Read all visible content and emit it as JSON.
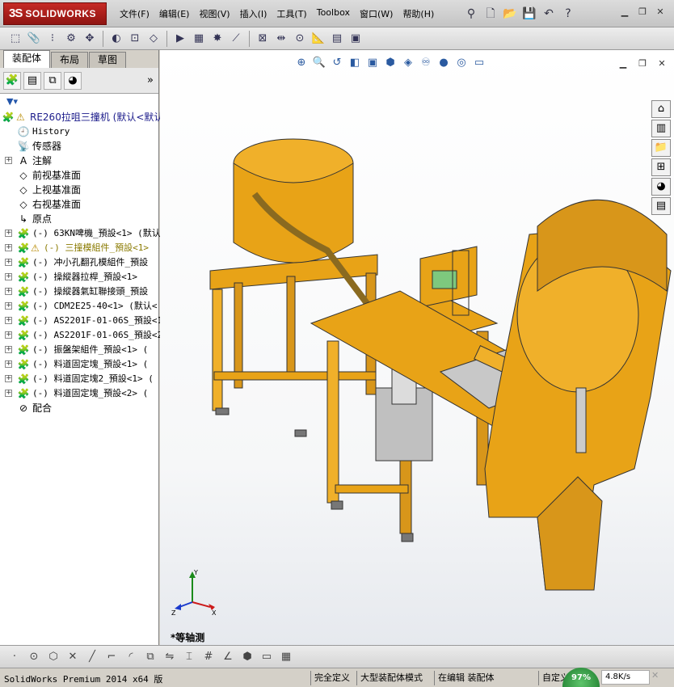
{
  "app": {
    "logo_ds": "3S",
    "logo_text": "SOLIDWORKS"
  },
  "menubar": [
    {
      "label": "文件(F)"
    },
    {
      "label": "编辑(E)"
    },
    {
      "label": "视图(V)"
    },
    {
      "label": "插入(I)"
    },
    {
      "label": "工具(T)"
    },
    {
      "label": "Toolbox"
    },
    {
      "label": "窗口(W)"
    },
    {
      "label": "帮助(H)"
    }
  ],
  "title_tools": [
    "pin-icon",
    "new-doc-icon",
    "open-icon",
    "save-icon",
    "undo-icon",
    "help-icon"
  ],
  "window_controls": [
    "minimize-icon",
    "restore-icon",
    "close-icon"
  ],
  "command_toolbar_icons": [
    "insert-component-icon",
    "mate-icon",
    "linear-pattern-icon",
    "smart-fasteners-icon",
    "move-component-icon",
    "show-hidden-icon",
    "assembly-features-icon",
    "reference-geometry-icon",
    "new-motion-study-icon",
    "bill-of-materials-icon",
    "exploded-view-icon",
    "explode-line-icon",
    "interference-detection-icon",
    "clearance-icon",
    "hole-alignment-icon",
    "measure-icon",
    "assembly-visualization-icon",
    "performance-icon"
  ],
  "feature_manager": {
    "tabs": [
      {
        "label": "装配体",
        "active": true
      },
      {
        "label": "布局",
        "active": false
      },
      {
        "label": "草图",
        "active": false
      }
    ],
    "panel_icons": [
      "featuremanager-icon",
      "propertymanager-icon",
      "configurationmanager-icon",
      "displaymanager-icon"
    ],
    "more": "»",
    "filter_icon": "filter-icon",
    "tree": [
      {
        "label": "RE260拉咀三撞机  (默认<默认",
        "icon": "assembly-icon",
        "warn": true,
        "expand": "",
        "top": true
      },
      {
        "label": "History",
        "icon": "history-icon",
        "warn": false,
        "expand": "",
        "sub": true
      },
      {
        "label": "传感器",
        "icon": "sensor-icon",
        "warn": false,
        "expand": ""
      },
      {
        "label": "注解",
        "icon": "annotation-icon",
        "warn": false,
        "expand": "+"
      },
      {
        "label": "前视基准面",
        "icon": "plane-icon",
        "warn": false,
        "expand": ""
      },
      {
        "label": "上视基准面",
        "icon": "plane-icon",
        "warn": false,
        "expand": ""
      },
      {
        "label": "右视基准面",
        "icon": "plane-icon",
        "warn": false,
        "expand": ""
      },
      {
        "label": "原点",
        "icon": "origin-icon",
        "warn": false,
        "expand": ""
      },
      {
        "label": "(-) 63KN啤機_預設<1> (默认",
        "icon": "subassembly-icon",
        "warn": false,
        "expand": "+",
        "sub": true
      },
      {
        "label": "(-) 三撞模組件_預設<1>",
        "icon": "subassembly-icon",
        "warn": true,
        "expand": "+",
        "sub": true
      },
      {
        "label": "(-) 冲小孔翻孔模組件_預設",
        "icon": "subassembly-icon",
        "warn": false,
        "expand": "+",
        "sub": true
      },
      {
        "label": "(-) 操縱器拉桿_預設<1>",
        "icon": "subassembly-icon",
        "warn": false,
        "expand": "+",
        "sub": true
      },
      {
        "label": "(-) 操縱器氣缸聯接頭_預設",
        "icon": "subassembly-icon",
        "warn": false,
        "expand": "+",
        "sub": true
      },
      {
        "label": "(-) CDM2E25-40<1> (默认<",
        "icon": "subassembly-icon",
        "warn": false,
        "expand": "+",
        "sub": true
      },
      {
        "label": "(-) AS2201F-01-06S_預設<1",
        "icon": "subassembly-icon",
        "warn": false,
        "expand": "+",
        "sub": true
      },
      {
        "label": "(-) AS2201F-01-06S_預設<2",
        "icon": "subassembly-icon",
        "warn": false,
        "expand": "+",
        "sub": true
      },
      {
        "label": "(-) 振盤架組件_預設<1> (",
        "icon": "subassembly-icon",
        "warn": false,
        "expand": "+",
        "sub": true
      },
      {
        "label": "(-) 料道固定塊_預設<1> (",
        "icon": "subassembly-icon",
        "warn": false,
        "expand": "+",
        "sub": true
      },
      {
        "label": "(-) 料道固定塊2_預設<1> (",
        "icon": "subassembly-icon",
        "warn": false,
        "expand": "+",
        "sub": true
      },
      {
        "label": "(-) 料道固定塊_預設<2> (",
        "icon": "subassembly-icon",
        "warn": false,
        "expand": "+",
        "sub": true
      },
      {
        "label": "配合",
        "icon": "mates-icon",
        "warn": false,
        "expand": ""
      }
    ]
  },
  "viewport": {
    "headsup_icons": [
      "zoom-to-fit-icon",
      "zoom-to-area-icon",
      "previous-view-icon",
      "section-view-icon",
      "dynamic-annotation-icon",
      "view-orientation-icon",
      "display-style-icon",
      "hide-show-items-icon",
      "edit-appearance-icon",
      "apply-scene-icon",
      "view-settings-icon"
    ],
    "view_name": "*等轴测",
    "taskpane_icons": [
      "solidworks-resources-icon",
      "design-library-icon",
      "file-explorer-icon",
      "view-palette-icon",
      "appearances-icon",
      "custom-properties-icon"
    ],
    "model_color": "#e8a317",
    "background_top": "#ffffff",
    "background_bottom": "#e6e9ee"
  },
  "view_toolbar_icons": [
    "point-icon",
    "circle-icon",
    "polygon-icon",
    "trim-icon",
    "line-icon",
    "corner-icon",
    "sketch-fillet-icon",
    "offset-icon",
    "mirror-icon",
    "smart-dimension-icon",
    "grid-icon",
    "angle-icon",
    "isometric-view-icon",
    "front-view-icon",
    "section-icon"
  ],
  "statusbar": {
    "app_text": "SolidWorks Premium 2014 x64 版",
    "fully_defined": "完全定义",
    "large_assembly": "大型装配体模式",
    "editing": "在编辑 装配体",
    "custom": "自定义",
    "net_percent": "97%",
    "net_speed": "4.8K/s"
  }
}
